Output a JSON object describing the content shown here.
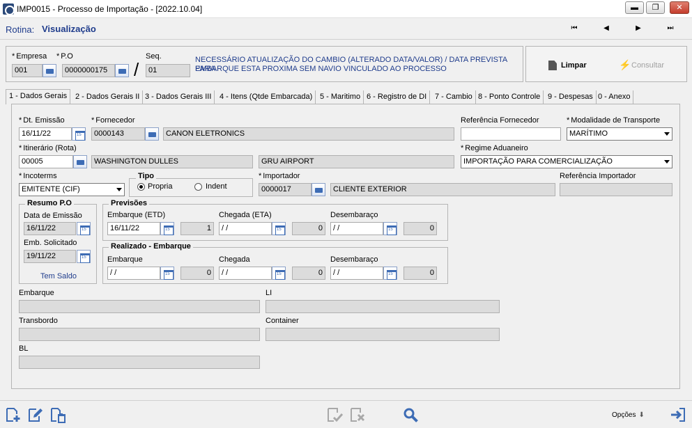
{
  "window": {
    "title": "IMP0015 - Processo de Importação - [2022.10.04]",
    "minimize_glyph": "▬",
    "restore_glyph": "❐",
    "close_glyph": "✕"
  },
  "rotina": {
    "label": "Rotina:",
    "value": "Visualização"
  },
  "nav": {
    "first": "⏮",
    "prev": "◀",
    "next": "▶",
    "last": "⏭"
  },
  "header": {
    "empresa_label": "Empresa",
    "empresa_value": "001",
    "po_label": "P.O",
    "po_value": "0000000175",
    "slash": "/",
    "seq_label": "Seq.",
    "seq_value": "01",
    "message_line1": "NECESSÁRIO ATUALIZAÇÃO DO CAMBIO (ALTERADO DATA/VALOR) / DATA PREVISTA PARA",
    "message_line2": "EMBARQUE ESTA PROXIMA SEM NAVIO VINCULADO AO PROCESSO",
    "limpar_label": "Limpar",
    "consultar_label": "Consultar"
  },
  "tabs": [
    "1 - Dados Gerais",
    "2 - Dados Gerais II",
    "3 - Dados Gerais III",
    "4 - Itens (Qtde Embarcada)",
    "5 - Maritimo",
    "6 - Registro de DI",
    "7 - Cambio",
    "8 - Ponto Controle",
    "9 - Despesas",
    "0 - Anexo"
  ],
  "form": {
    "dt_emissao_label": "Dt. Emissão",
    "dt_emissao_value": "16/11/22",
    "fornecedor_label": "Fornecedor",
    "fornecedor_code": "0000143",
    "fornecedor_name": "CANON ELETRONICS",
    "ref_fornecedor_label": "Referência Fornecedor",
    "ref_fornecedor_value": "",
    "modalidade_label": "Modalidade de Transporte",
    "modalidade_value": "MARÍTIMO",
    "itinerario_label": "Itinerário (Rota)",
    "itinerario_code": "00005",
    "itinerario_origem": "WASHINGTON DULLES",
    "itinerario_destino": "GRU AIRPORT",
    "regime_label": "Regime Aduaneiro",
    "regime_value": "IMPORTAÇÃO PARA COMERCIALIZAÇÃO",
    "incoterms_label": "Incoterms",
    "incoterms_value": "EMITENTE (CIF)",
    "tipo_label": "Tipo",
    "tipo_propria": "Propria",
    "tipo_indent": "Indent",
    "importador_label": "Importador",
    "importador_code": "0000017",
    "importador_name": "CLIENTE EXTERIOR",
    "ref_importador_label": "Referência Importador",
    "ref_importador_value": ""
  },
  "resumo_po": {
    "title": "Resumo P.O",
    "data_emissao_label": "Data de Emissão",
    "data_emissao_value": "16/11/22",
    "emb_solicitado_label": "Emb. Solicitado",
    "emb_solicitado_value": "19/11/22",
    "saldo_text": "Tem Saldo"
  },
  "previsoes": {
    "title": "Previsões",
    "embarque_label": "Embarque (ETD)",
    "embarque_value": "16/11/22",
    "embarque_count": "1",
    "chegada_label": "Chegada (ETA)",
    "chegada_value": " / /",
    "chegada_count": "0",
    "desembaraco_label": "Desembaraço",
    "desembaraco_value": " / /",
    "desembaraco_count": "0"
  },
  "realizado": {
    "title": "Realizado - Embarque",
    "embarque_label": "Embarque",
    "embarque_value": " / /",
    "embarque_count": "0",
    "chegada_label": "Chegada",
    "chegada_value": " / /",
    "chegada_count": "0",
    "desembaraco_label": "Desembaraço",
    "desembaraco_value": " / /",
    "desembaraco_count": "0"
  },
  "bottom_fields": {
    "embarque_label": "Embarque",
    "embarque_value": "",
    "li_label": "LI",
    "li_value": "",
    "transbordo_label": "Transbordo",
    "transbordo_value": "",
    "container_label": "Container",
    "container_value": "",
    "bl_label": "BL",
    "bl_value": ""
  },
  "footer": {
    "opcoes_label": "Opções"
  },
  "colors": {
    "accent_blue": "#1f3c8c",
    "icon_blue": "#3d6cb5",
    "readonly_gray": "#dcdcdc",
    "window_bg": "#f0f0f0"
  }
}
